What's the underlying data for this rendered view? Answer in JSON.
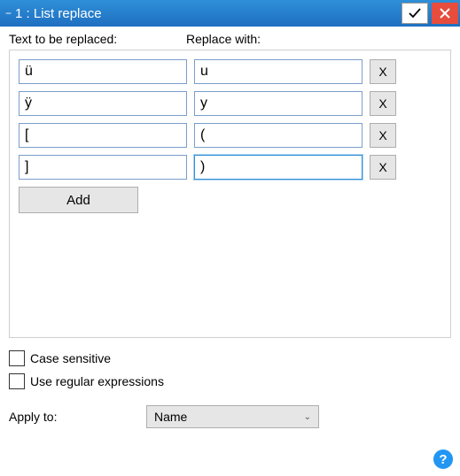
{
  "window": {
    "title": "1 : List replace"
  },
  "headers": {
    "left": "Text to be replaced:",
    "right": "Replace with:"
  },
  "rows": [
    {
      "find": "ü",
      "replace": "u"
    },
    {
      "find": "ÿ",
      "replace": "y"
    },
    {
      "find": "[",
      "replace": "("
    },
    {
      "find": "]",
      "replace": ")"
    }
  ],
  "buttons": {
    "delete": "X",
    "add": "Add"
  },
  "options": {
    "case_sensitive": "Case sensitive",
    "regex": "Use regular expressions"
  },
  "apply": {
    "label": "Apply to:",
    "value": "Name"
  },
  "help": "?"
}
